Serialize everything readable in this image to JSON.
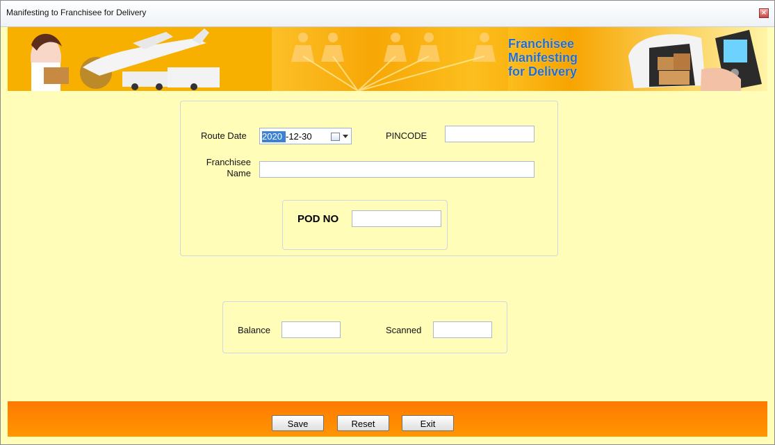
{
  "window": {
    "title": "Manifesting to Franchisee for Delivery"
  },
  "banner": {
    "line1": "Franchisee",
    "line2": "Manifesting",
    "line3": "for Delivery"
  },
  "form": {
    "route_date_label": "Route Date",
    "route_date_year": "2020",
    "route_date_rest": "-12-30",
    "pincode_label": "PINCODE",
    "pincode_value": "",
    "franchisee_label_line1": "Franchisee",
    "franchisee_label_line2": "Name",
    "franchisee_value": "",
    "pod_label": "POD NO",
    "pod_value": ""
  },
  "summary": {
    "balance_label": "Balance",
    "balance_value": "",
    "scanned_label": "Scanned",
    "scanned_value": ""
  },
  "actions": {
    "save": "Save",
    "reset": "Reset",
    "exit": "Exit"
  }
}
